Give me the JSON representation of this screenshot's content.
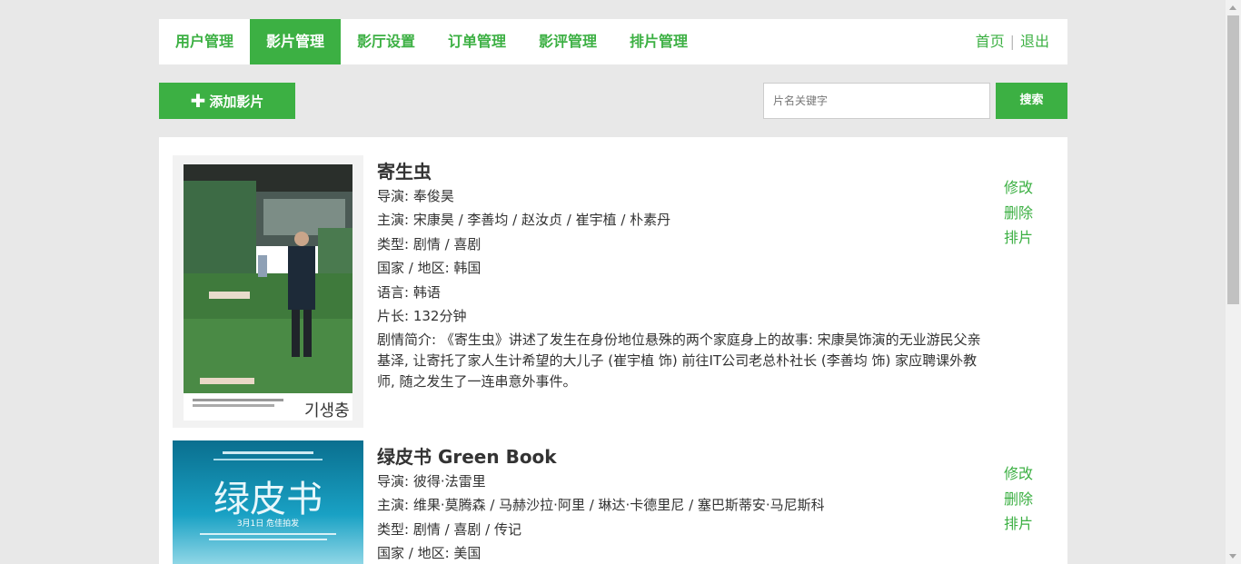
{
  "nav": {
    "tabs": [
      "用户管理",
      "影片管理",
      "影厅设置",
      "订单管理",
      "影评管理",
      "排片管理"
    ],
    "active_index": 1,
    "home": "首页",
    "separator": "|",
    "logout": "退出"
  },
  "toolbar": {
    "add_label": "添加影片",
    "search_placeholder": "片名关键字",
    "search_label": "搜索"
  },
  "movies": [
    {
      "title": "寄生虫",
      "director": "导演: 奉俊昊",
      "cast": "主演: 宋康昊 / 李善均 / 赵汝贞 / 崔宇植 / 朴素丹",
      "genre": "类型: 剧情 / 喜剧",
      "region": "国家 / 地区: 韩国",
      "language": "语言: 韩语",
      "duration": "片长: 132分钟",
      "summary": "剧情简介: 《寄生虫》讲述了发生在身份地位悬殊的两个家庭身上的故事: 宋康昊饰演的无业游民父亲基泽, 让寄托了家人生计希望的大儿子 (崔宇植 饰) 前往IT公司老总朴社长 (李善均 饰) 家应聘课外教师, 随之发生了一连串意外事件。",
      "poster_text": "기생충",
      "actions": {
        "edit": "修改",
        "delete": "删除",
        "schedule": "排片"
      }
    },
    {
      "title": "绿皮书 Green Book",
      "director": "导演: 彼得·法雷里",
      "cast": "主演: 维果·莫腾森 / 马赫沙拉·阿里 / 琳达·卡德里尼 / 塞巴斯蒂安·马尼斯科",
      "genre": "类型: 剧情 / 喜剧 / 传记",
      "region": "国家 / 地区: 美国",
      "poster_text": "绿皮书",
      "poster_date": "3月1日 危佳拍发",
      "actions": {
        "edit": "修改",
        "delete": "删除",
        "schedule": "排片"
      }
    }
  ],
  "colors": {
    "accent": "#3cb043",
    "background": "#e8e8e8"
  }
}
